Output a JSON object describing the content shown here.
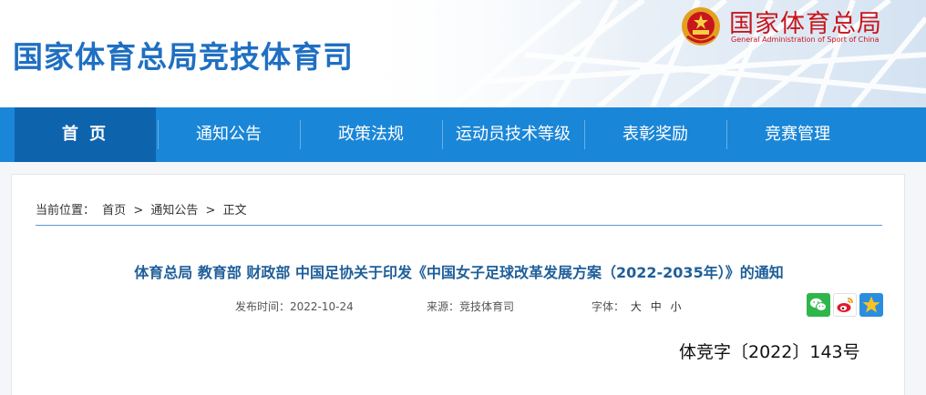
{
  "header": {
    "site_title": "国家体育总局竞技体育司",
    "org_name_cn": "国家体育总局",
    "org_name_en": "General Administration of Sport of China",
    "emblem_icon": "national-emblem-icon"
  },
  "nav": {
    "items": [
      {
        "label": "首 页",
        "active": true
      },
      {
        "label": "通知公告",
        "active": false
      },
      {
        "label": "政策法规",
        "active": false
      },
      {
        "label": "运动员技术等级",
        "active": false
      },
      {
        "label": "表彰奖励",
        "active": false
      },
      {
        "label": "竞赛管理",
        "active": false
      }
    ]
  },
  "breadcrumb": {
    "prefix": "当前位置：",
    "items": [
      "首页",
      "通知公告",
      "正文"
    ],
    "separator": ">"
  },
  "article": {
    "title": "体育总局 教育部 财政部 中国足协关于印发《中国女子足球改革发展方案（2022-2035年）》的通知",
    "date_label": "发布时间：",
    "date": "2022-10-24",
    "source_label": "来源：",
    "source": "竞技体育司",
    "font_label": "字体：",
    "font_options": [
      "大",
      "中",
      "小"
    ],
    "doc_number": "体竞字〔2022〕143号"
  },
  "share": {
    "icons": [
      "wechat-icon",
      "weibo-icon",
      "qzone-icon"
    ]
  },
  "colors": {
    "nav_bg": "#1a86d7",
    "nav_active": "#0e63ad",
    "title_blue": "#1f6fc2",
    "brand_red": "#c8161d"
  }
}
